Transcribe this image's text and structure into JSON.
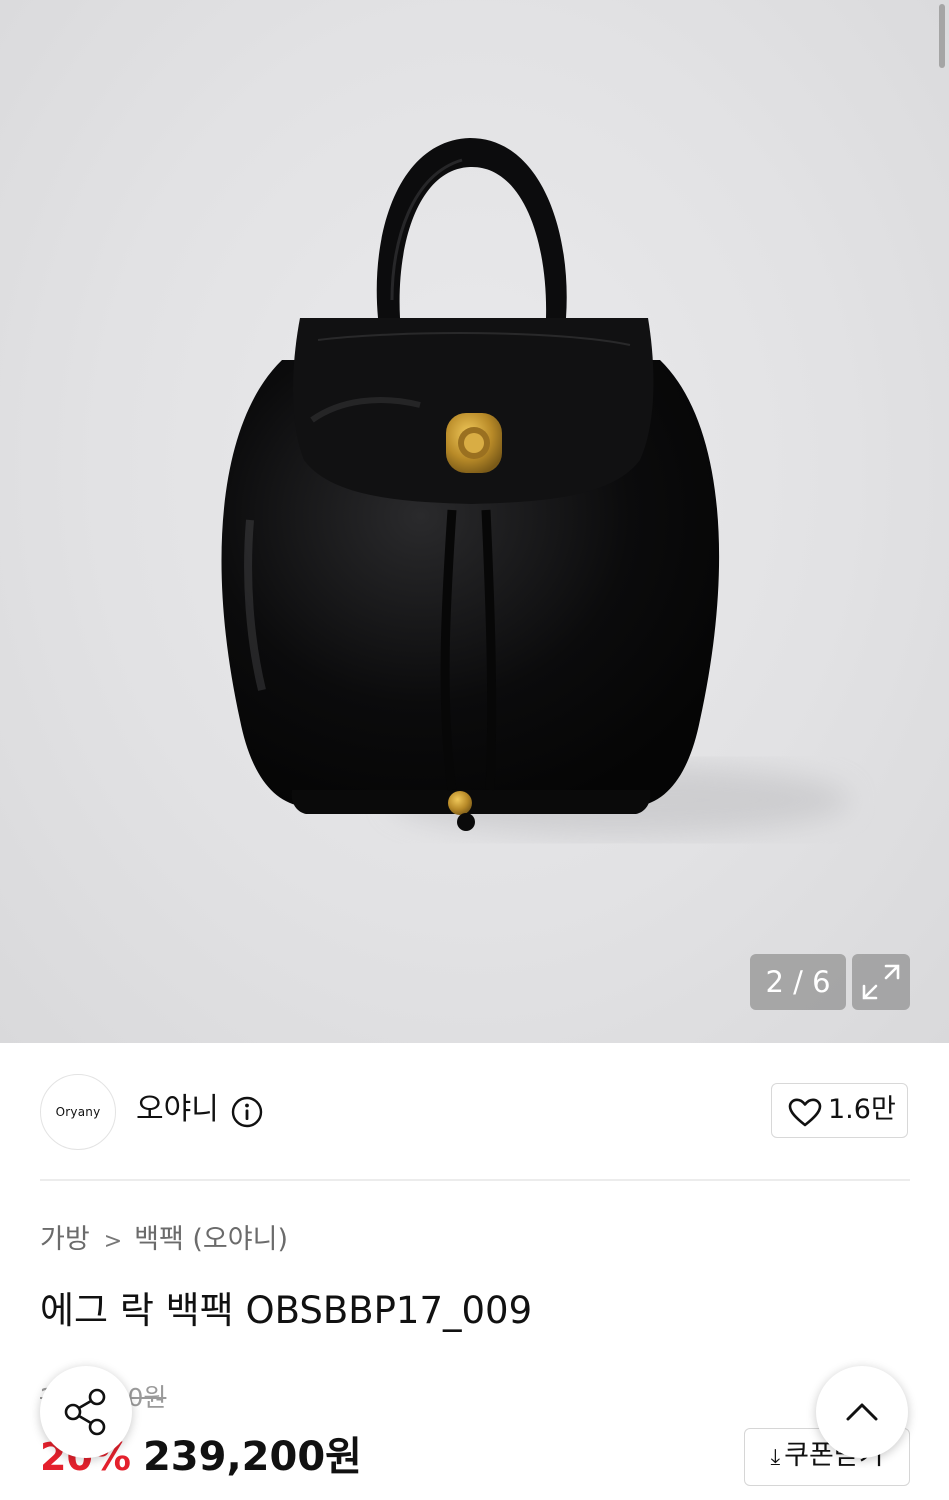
{
  "gallery": {
    "counter": "2 / 6",
    "current": 2,
    "total": 6,
    "image_alt": "black leather backpack"
  },
  "brand": {
    "logo_text": "Oryany",
    "name": "오야니",
    "likes": "1.6만"
  },
  "breadcrumb": {
    "category": "가방",
    "subcategory": "백팩 (오야니)"
  },
  "product": {
    "title": "에그 락 백팩 OBSBBP17_009",
    "original_price": "299,000원",
    "discount": "20%",
    "sale_price": "239,200원"
  },
  "actions": {
    "coupon_label": "쿠폰받기"
  },
  "icons": [
    "expand-icon",
    "info-icon",
    "heart-icon",
    "share-icon",
    "chevron-up-icon",
    "download-icon"
  ],
  "colors": {
    "discount": "#e4202c",
    "muted_text": "#6b6b6b",
    "border": "#d8d8d8"
  }
}
